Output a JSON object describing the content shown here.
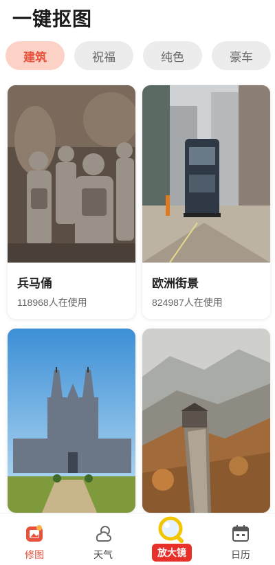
{
  "header": {
    "title": "一键抠图"
  },
  "tabs": [
    {
      "label": "建筑",
      "active": true
    },
    {
      "label": "祝福",
      "active": false
    },
    {
      "label": "纯色",
      "active": false
    },
    {
      "label": "豪车",
      "active": false
    }
  ],
  "cards": [
    {
      "title": "兵马俑",
      "usage": "118968人在使用"
    },
    {
      "title": "欧洲街景",
      "usage": "824987人在使用"
    },
    {
      "title": "",
      "usage": ""
    },
    {
      "title": "",
      "usage": ""
    }
  ],
  "bottom_nav": [
    {
      "label": "修图",
      "icon": "photo-edit-icon",
      "active": true
    },
    {
      "label": "天气",
      "icon": "weather-icon",
      "active": false
    },
    {
      "label": "放大镜",
      "icon": "magnifier-icon",
      "active": false
    },
    {
      "label": "日历",
      "icon": "calendar-icon",
      "active": false
    }
  ],
  "colors": {
    "accent": "#e8523c",
    "tab_active_bg": "#fcd2c6",
    "tab_bg": "#ececec"
  }
}
